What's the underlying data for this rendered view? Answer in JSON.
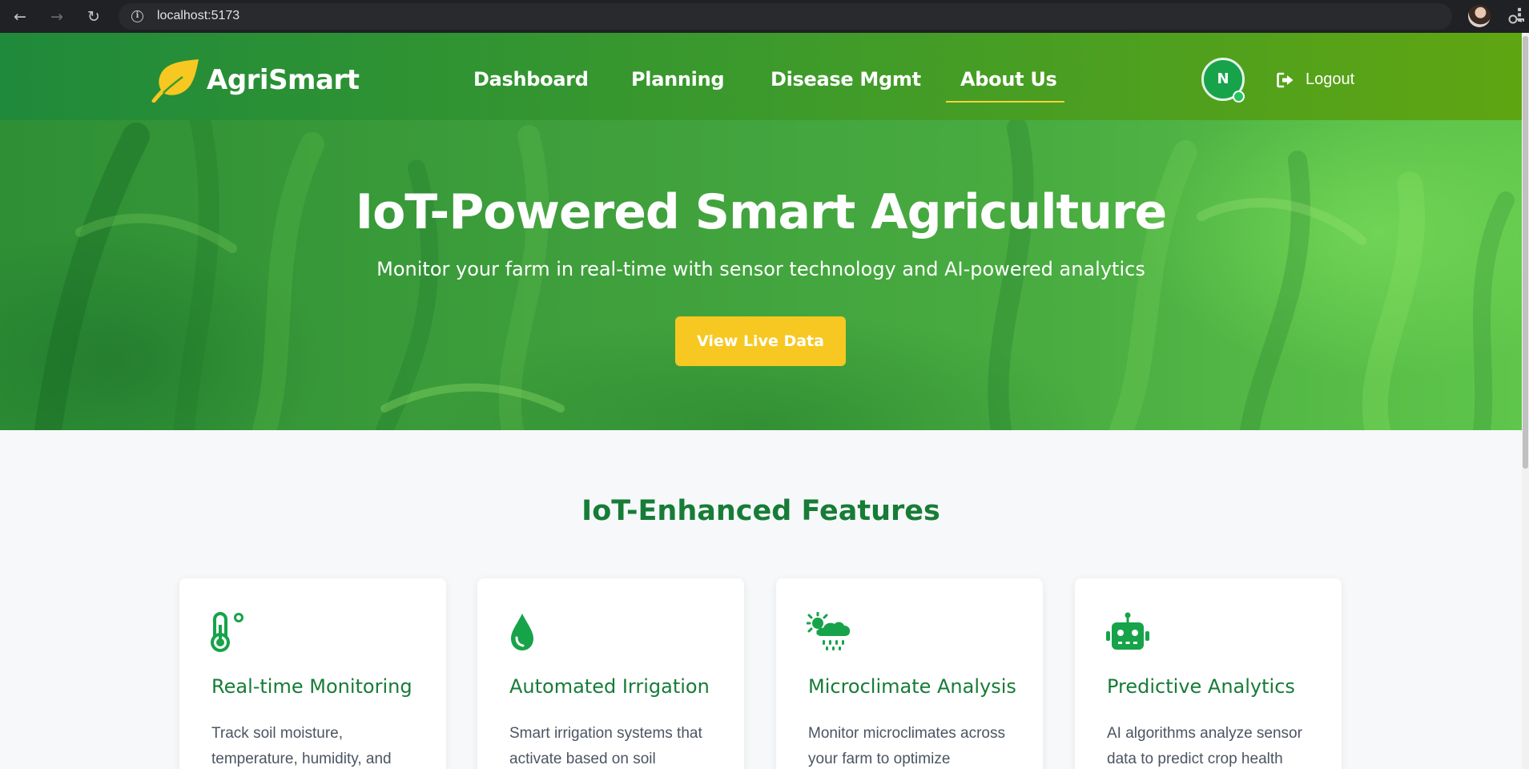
{
  "browser": {
    "url": "localhost:5173"
  },
  "brand": {
    "name": "AgriSmart",
    "accent": "#f6c821",
    "primary": "#177c37"
  },
  "nav": {
    "links": [
      {
        "label": "Dashboard"
      },
      {
        "label": "Planning"
      },
      {
        "label": "Disease Mgmt"
      },
      {
        "label": "About Us",
        "active": true
      }
    ],
    "avatar_initial": "N",
    "logout_label": "Logout"
  },
  "hero": {
    "title": "IoT-Powered Smart Agriculture",
    "subtitle": "Monitor your farm in real-time with sensor technology and AI-powered analytics",
    "cta_label": "View Live Data"
  },
  "features": {
    "title": "IoT-Enhanced Features",
    "cards": [
      {
        "icon": "thermometer-icon",
        "title": "Real-time Monitoring",
        "desc": "Track soil moisture, temperature, humidity, and"
      },
      {
        "icon": "water-drop-icon",
        "title": "Automated Irrigation",
        "desc": "Smart irrigation systems that activate based on soil"
      },
      {
        "icon": "cloud-sun-rain-icon",
        "title": "Microclimate Analysis",
        "desc": "Monitor microclimates across your farm to optimize"
      },
      {
        "icon": "robot-icon",
        "title": "Predictive Analytics",
        "desc": "AI algorithms analyze sensor data to predict crop health"
      }
    ]
  }
}
